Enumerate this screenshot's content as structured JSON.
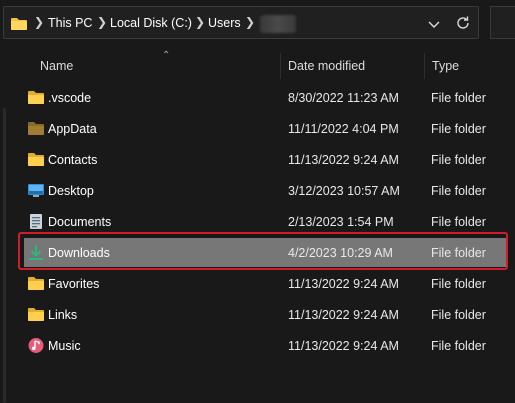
{
  "address_bar": {
    "breadcrumbs": [
      "This PC",
      "Local Disk (C:)",
      "Users"
    ],
    "icons": [
      "folder-icon",
      "chevron-right-icon",
      "chevron-down-icon",
      "refresh-icon"
    ]
  },
  "columns": {
    "name": "Name",
    "date_modified": "Date modified",
    "type": "Type"
  },
  "files": [
    {
      "name": ".vscode",
      "date": "8/30/2022 11:23 AM",
      "type": "File folder",
      "icon": "folder-icon"
    },
    {
      "name": "AppData",
      "date": "11/11/2022 4:04 PM",
      "type": "File folder",
      "icon": "folder-dim-icon"
    },
    {
      "name": "Contacts",
      "date": "11/13/2022 9:24 AM",
      "type": "File folder",
      "icon": "contacts-folder-icon"
    },
    {
      "name": "Desktop",
      "date": "3/12/2023 10:57 AM",
      "type": "File folder",
      "icon": "desktop-icon"
    },
    {
      "name": "Documents",
      "date": "2/13/2023 1:54 PM",
      "type": "File folder",
      "icon": "documents-icon"
    },
    {
      "name": "Downloads",
      "date": "4/2/2023 10:29 AM",
      "type": "File folder",
      "icon": "download-icon"
    },
    {
      "name": "Favorites",
      "date": "11/13/2022 9:24 AM",
      "type": "File folder",
      "icon": "favorites-folder-icon"
    },
    {
      "name": "Links",
      "date": "11/13/2022 9:24 AM",
      "type": "File folder",
      "icon": "links-folder-icon"
    },
    {
      "name": "Music",
      "date": "11/13/2022 9:24 AM",
      "type": "File folder",
      "icon": "music-icon"
    }
  ],
  "selected_item": "Downloads",
  "colors": {
    "background": "#191919",
    "selection": "#777777",
    "highlight_border": "#d01f2a",
    "folder_yellow": "#f4c242"
  }
}
